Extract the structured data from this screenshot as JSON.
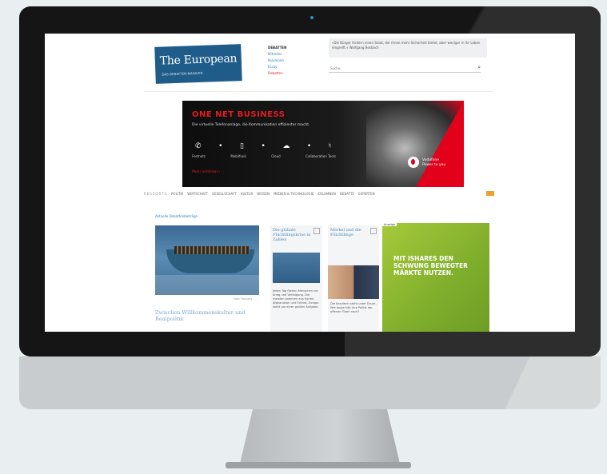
{
  "site": {
    "logo_name": "The European",
    "logo_tagline": "DAS DEBATTEN-MAGAZIN"
  },
  "nav": {
    "heading": "DEBATTEN",
    "items": [
      "Mitreden",
      "Kolumnen",
      "Essay",
      "Debatten"
    ]
  },
  "teaser_text": "»Die Bürger fordern einen Staat, der ihnen mehr Sicherheit bietet, aber weniger in ihr Leben eingreift.« Wolfgang Bosbach",
  "search": {
    "placeholder": "Suche",
    "icon": "magnifier-icon"
  },
  "ad": {
    "headline": "ONE NET BUSINESS",
    "subline": "Die virtuelle Telefonanlage, die Kommunikation effizienter macht.",
    "icons": [
      "phone-icon",
      "mobile-icon",
      "cloud-icon",
      "headset-icon"
    ],
    "labels": [
      "Festnetz",
      "Mobilfunk",
      "Cloud",
      "Collaboration Tools"
    ],
    "cta": "Mehr erfahren ›",
    "brand": "Vodafone",
    "brand_sub": "Power to you"
  },
  "ressorts": {
    "label": "RESSORTS",
    "items": [
      "POLITIK",
      "WIRTSCHAFT",
      "GESELLSCHAFT",
      "KULTUR",
      "WISSEN",
      "MEDIEN & TECHNOLOGIE",
      "KOLUMNEN",
      "DEBATTE",
      "EXPERTEN"
    ]
  },
  "section_label": "Aktuelle Debattenbeiträge",
  "main_story": {
    "caption": "Foto: Reuters",
    "headline": "Zwischen Willkommenskultur und Realpolitik"
  },
  "card2": {
    "title": "Die globale Flüchtlingskrise in Zahlen",
    "text": "Jeden Tag fliehen Menschen vor Krieg und Verfolgung. Die meisten kommen aus Syrien, Afghanistan und Eritrea. Europa steht vor einer großen Aufgabe."
  },
  "card3": {
    "title": "Merkel und die Flüchtlinge",
    "text": "Die Kanzlerin steht unter Druck. Wie lange hält ihre Politik der offenen Türen noch?"
  },
  "green_ad": {
    "label": "Anzeige",
    "message": "MIT ISHARES DEN SCHWUNG BEWEGTER MÄRKTE NUTZEN."
  },
  "colors": {
    "brand_blue": "#1f5c8a",
    "ad_red": "#e2001a",
    "green_ad": "#8dbb30"
  }
}
